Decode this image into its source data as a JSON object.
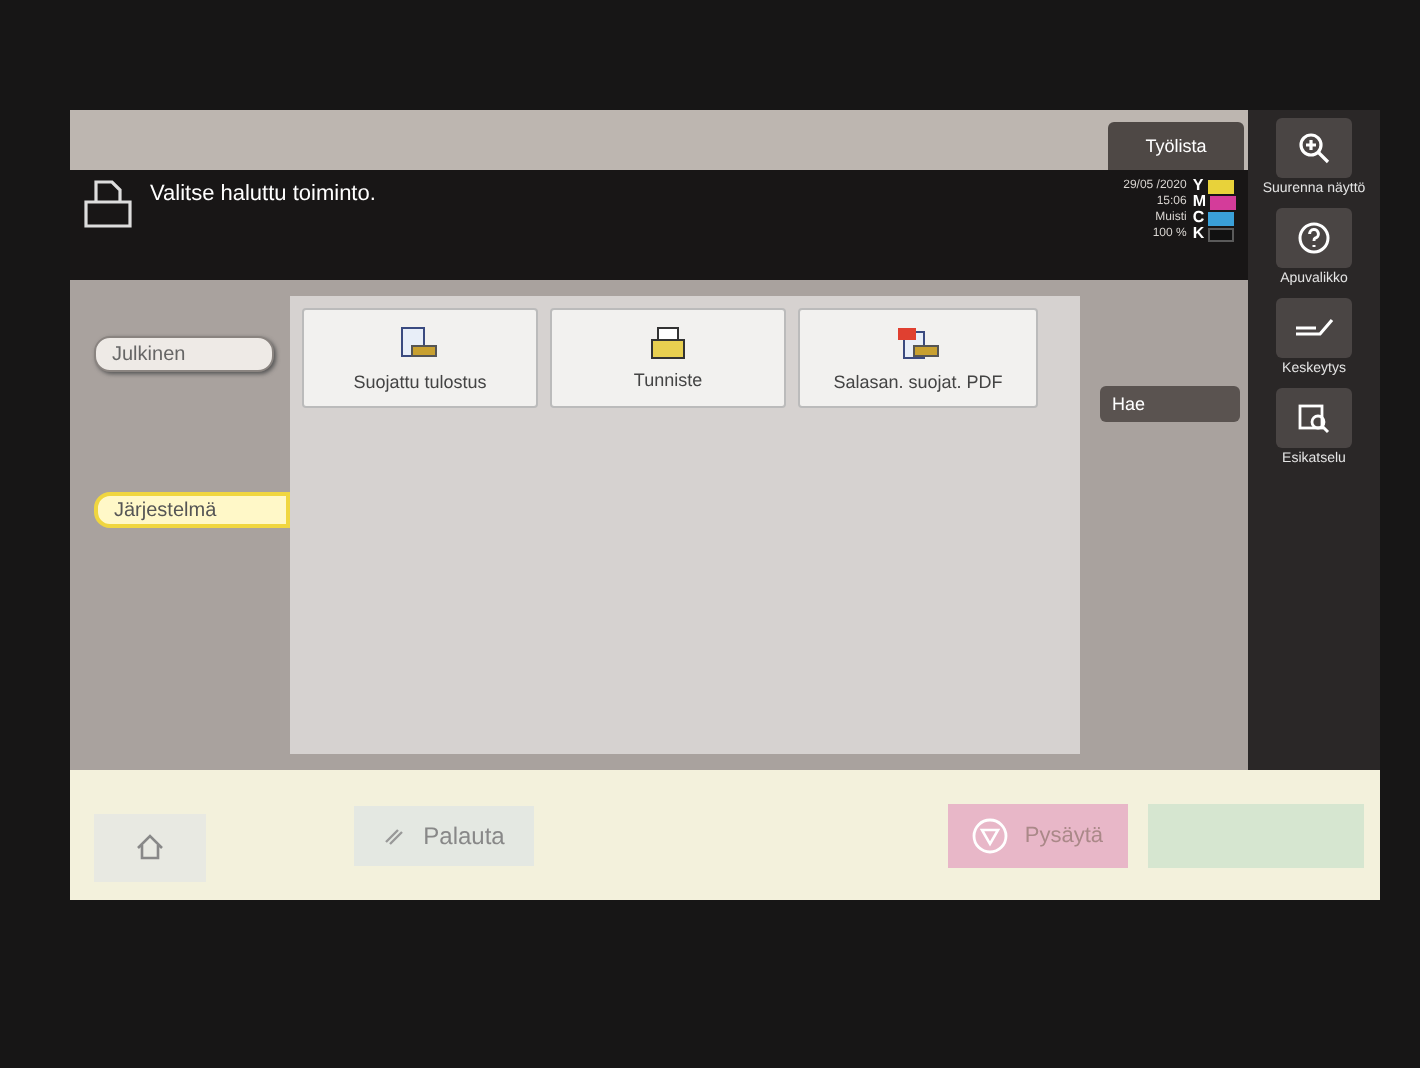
{
  "top_tab": "Työlista",
  "header": {
    "message": "Valitse haluttu toiminto.",
    "date": "29/05 /2020",
    "time": "15:06",
    "memory_label": "Muisti",
    "memory_value": "100 %",
    "toners": [
      {
        "letter": "Y",
        "color": "#e8d23a",
        "level": 1
      },
      {
        "letter": "M",
        "color": "#d43c9a",
        "level": 1
      },
      {
        "letter": "C",
        "color": "#3aa0d8",
        "level": 1
      },
      {
        "letter": "K",
        "color": "#5a5a5a",
        "level": 0
      }
    ]
  },
  "side_tabs": [
    {
      "label": "Julkinen",
      "selected": false
    },
    {
      "label": "Järjestelmä",
      "selected": true
    }
  ],
  "tiles": [
    {
      "label": "Suojattu tulostus",
      "kind": "secure"
    },
    {
      "label": "Tunniste",
      "kind": "id"
    },
    {
      "label": "Salasan. suojat. PDF",
      "kind": "pdf"
    }
  ],
  "search_button": "Hae",
  "right_buttons": [
    {
      "label": "Suurenna näyttö",
      "kind": "zoom"
    },
    {
      "label": "Apuvalikko",
      "kind": "help"
    },
    {
      "label": "Keskeytys",
      "kind": "interrupt"
    },
    {
      "label": "Esikatselu",
      "kind": "preview"
    }
  ],
  "bottom": {
    "reset": "Palauta",
    "stop": "Pysäytä"
  }
}
